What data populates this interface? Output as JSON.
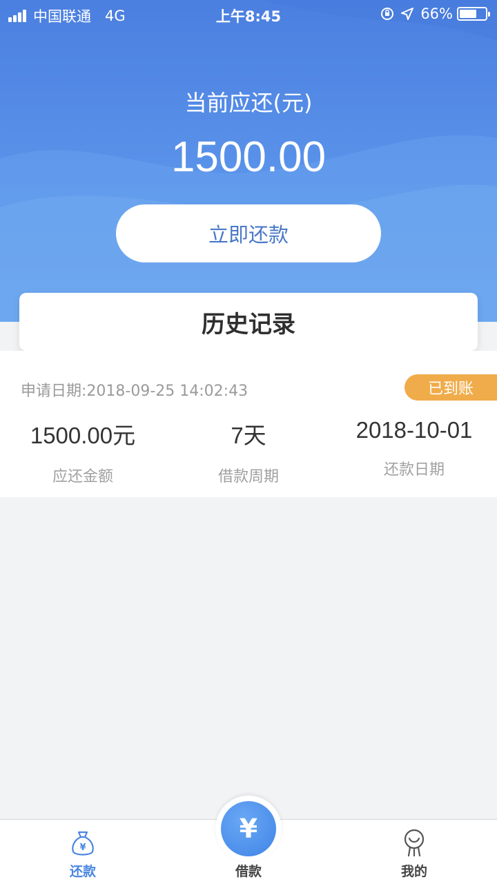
{
  "status_bar": {
    "carrier": "中国联通",
    "network": "4G",
    "time": "上午8:45",
    "battery": "66%",
    "battery_level": 0.66
  },
  "summary": {
    "due_label": "当前应还(元)",
    "due_amount": "1500.00",
    "repay_button": "立即还款"
  },
  "history": {
    "title": "历史记录"
  },
  "record": {
    "apply_date": "申请日期:2018-09-25 14:02:43",
    "status": "已到账",
    "stats": [
      {
        "value": "1500.00元",
        "label": "应还金额"
      },
      {
        "value": "7天",
        "label": "借款周期"
      },
      {
        "value": "2018-10-01",
        "label": "还款日期"
      }
    ]
  },
  "tabbar": {
    "items": [
      {
        "label": "还款",
        "icon": "repay-bag-icon"
      },
      {
        "label": "借款",
        "icon": "yuan-coin-icon"
      },
      {
        "label": "我的",
        "icon": "profile-icon"
      }
    ],
    "center_symbol": "¥",
    "colors": {
      "active": "#4a86e0",
      "inactive": "#444444"
    }
  },
  "colors": {
    "accent": "#4b7fe0",
    "badge": "#f0ac4a",
    "background": "#f2f3f5"
  }
}
